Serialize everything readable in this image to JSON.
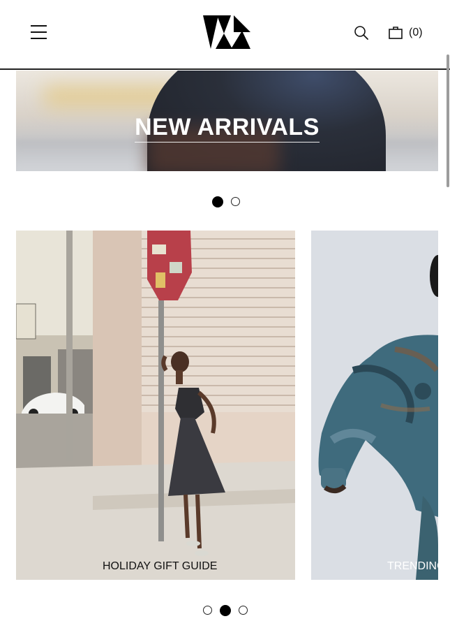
{
  "header": {
    "menu_icon": "hamburger-menu-icon",
    "logo_icon": "brand-logo-icon",
    "search_icon": "search-icon",
    "bag_icon": "shopping-bag-icon",
    "cart_count": "(0)"
  },
  "hero": {
    "title": "NEW ARRIVALS",
    "dots_total": 2,
    "dots_active": 1
  },
  "carousel": {
    "cards": [
      {
        "label": "HOLIDAY GIFT GUIDE"
      },
      {
        "label": "TRENDING"
      }
    ],
    "dots_total": 3,
    "dots_active": 2
  },
  "colors": {
    "text": "#111111",
    "background": "#ffffff",
    "dot_active": "#000000"
  }
}
